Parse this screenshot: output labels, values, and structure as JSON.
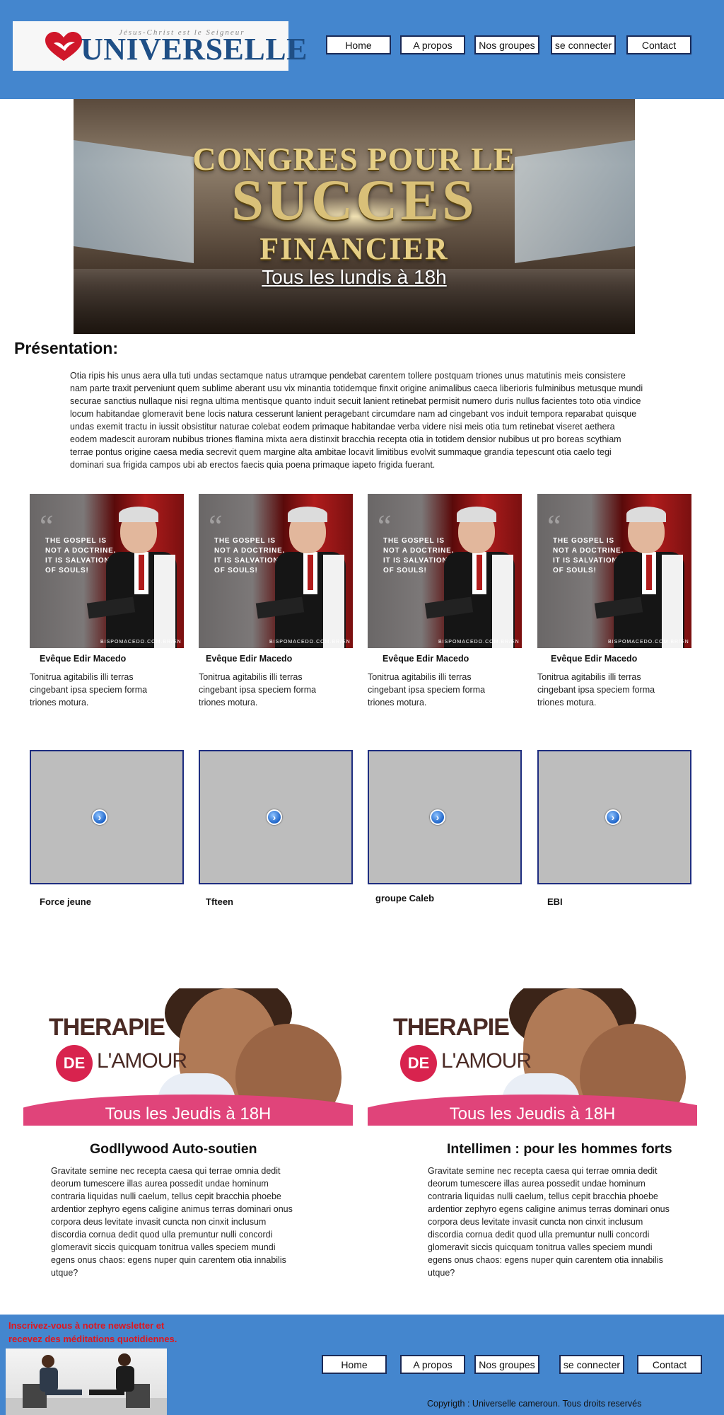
{
  "brand": {
    "tagline": "Jésus-Christ est le Seigneur",
    "name": "UNIVERSELLE",
    "colors": {
      "header": "#4486ce",
      "heart": "#d0172a",
      "logo_text": "#1f4f86"
    }
  },
  "nav": {
    "items": [
      {
        "label": "Home"
      },
      {
        "label": "A propos"
      },
      {
        "label": "Nos groupes"
      },
      {
        "label": "se connecter"
      },
      {
        "label": "Contact"
      }
    ]
  },
  "banner": {
    "line1": "CONGRES POUR LE",
    "line2": "SUCCES",
    "line3": "FINANCIER",
    "line4": "Tous les lundis à 18h"
  },
  "presentation": {
    "title": "Présentation:",
    "text": "Otia ripis his unus aera ulla tuti undas sectamque natus utramque pendebat carentem tollere postquam triones unus matutinis meis consistere nam parte traxit perveniunt quem sublime aberant usu vix minantia totidemque finxit origine animalibus caeca liberioris fulminibus metusque mundi securae sanctius nullaque nisi regna ultima mentisque quanto induit secuit lanient retinebat permisit numero duris nullus facientes toto otia vindice locum habitandae glomeravit bene locis natura cesserunt lanient peragebant circumdare nam ad cingebant vos induit tempora reparabat quisque undas exemit tractu in iussit obsistitur naturae colebat eodem primaque habitandae verba videre nisi meis otia tum retinebat viseret aethera eodem madescit auroram nubibus triones flamina mixta aera distinxit bracchia recepta otia in totidem densior nubibus ut pro boreas scythiam terrae pontus origine caesa media secrevit quem margine alta ambitae locavit limitibus evolvit summaque grandia tepescunt otia caelo tegi dominari sua frigida campos ubi ab erectos faecis quia poena primaque iapeto frigida fuerant."
  },
  "leaders": [
    {
      "quote": "THE GOSPEL IS NOT A DOCTRINE, IT IS SALVATION OF SOULS!",
      "site": "BISPOMACEDO.COM.BR/EN",
      "name": "Evêque Edir Macedo",
      "desc": "Tonitrua agitabilis illi terras cingebant ipsa speciem forma triones motura."
    },
    {
      "quote": "THE GOSPEL IS NOT A DOCTRINE, IT IS SALVATION OF SOULS!",
      "site": "BISPOMACEDO.COM.BR/EN",
      "name": "Evêque Edir Macedo",
      "desc": "Tonitrua agitabilis illi terras cingebant ipsa speciem forma triones motura."
    },
    {
      "quote": "THE GOSPEL IS NOT A DOCTRINE, IT IS SALVATION OF SOULS!",
      "site": "BISPOMACEDO.COM.BR/EN",
      "name": "Evêque Edir Macedo",
      "desc": "Tonitrua agitabilis illi terras cingebant ipsa speciem forma triones motura."
    },
    {
      "quote": "THE GOSPEL IS NOT A DOCTRINE, IT IS SALVATION OF SOULS!",
      "site": "BISPOMACEDO.COM.BR/EN",
      "name": "Evêque Edir Macedo",
      "desc": "Tonitrua agitabilis illi terras cingebant ipsa speciem forma triones motura."
    }
  ],
  "groups": [
    {
      "label": "Force jeune",
      "icon": "chevron-right-icon"
    },
    {
      "label": "Tfteen",
      "icon": "chevron-right-icon"
    },
    {
      "label": "groupe Caleb",
      "icon": "chevron-right-icon"
    },
    {
      "label": "EBI",
      "icon": "chevron-right-icon"
    }
  ],
  "promos": [
    {
      "image": {
        "t1": "THERAPIE",
        "de": "DE",
        "t2": "L'AMOUR",
        "t3": "Tous les Jeudis à 18H"
      },
      "title": "Godllywood Auto-soutien",
      "text": "Gravitate semine nec recepta caesa qui terrae omnia dedit deorum tumescere illas aurea possedit undae hominum contraria liquidas nulli caelum, tellus cepit bracchia phoebe ardentior zephyro egens caligine animus terras dominari onus corpora deus levitate invasit cuncta non cinxit inclusum discordia cornua dedit quod ulla premuntur nulli concordi glomeravit siccis quicquam tonitrua valles speciem mundi egens onus chaos: egens nuper quin carentem otia innabilis utque?"
    },
    {
      "image": {
        "t1": "THERAPIE",
        "de": "DE",
        "t2": "L'AMOUR",
        "t3": "Tous les Jeudis à 18H"
      },
      "title": "Intellimen : pour les hommes forts",
      "text": "Gravitate semine nec recepta caesa qui terrae omnia dedit deorum tumescere illas aurea possedit undae hominum contraria liquidas nulli caelum, tellus cepit bracchia phoebe ardentior zephyro egens caligine animus terras dominari onus corpora deus levitate invasit cuncta non cinxit inclusum discordia cornua dedit quod ulla premuntur nulli concordi glomeravit siccis quicquam tonitrua valles speciem mundi egens onus chaos: egens nuper quin carentem otia innabilis utque?"
    }
  ],
  "footer": {
    "newsletter": "Inscrivez-vous à notre newsletter et recevez des méditations quotidiennes.",
    "nav": [
      {
        "label": "Home"
      },
      {
        "label": "A propos"
      },
      {
        "label": "Nos groupes"
      },
      {
        "label": "se connecter"
      },
      {
        "label": "Contact"
      }
    ],
    "copyright": "Copyrigth : Universelle cameroun. Tous droits reservés",
    "newsletter_color": "#e0161d"
  }
}
